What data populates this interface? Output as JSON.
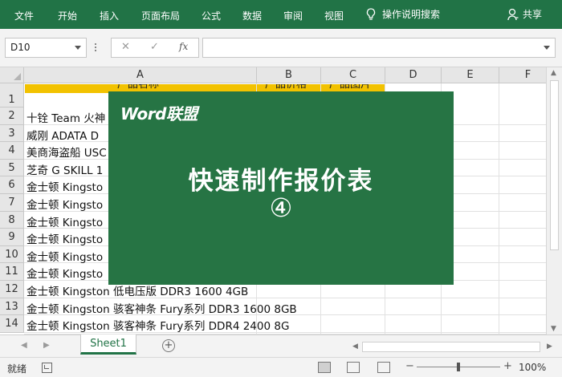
{
  "ribbon": {
    "tabs": [
      "文件",
      "开始",
      "插入",
      "页面布局",
      "公式",
      "数据",
      "审阅",
      "视图"
    ],
    "tell_me": "操作说明搜索",
    "share": "共享",
    "icons": {
      "tell_me": "lightbulb-icon",
      "share": "user-icon"
    }
  },
  "formula_bar": {
    "name_box": "D10",
    "cancel_symbol": "✕",
    "enter_symbol": "✓",
    "fx_symbol": "fx",
    "formula": ""
  },
  "grid": {
    "columns": [
      "A",
      "B",
      "C",
      "D",
      "E",
      "F"
    ],
    "header_row": [
      "产品名称",
      "产品价格",
      "产品图片"
    ],
    "rows": [
      "1",
      "2",
      "3",
      "4",
      "5",
      "6",
      "7",
      "8",
      "9",
      "10",
      "11",
      "12",
      "13",
      "14"
    ],
    "cells_a": [
      "",
      "十铨 Team 火神",
      "威刚 ADATA D",
      "美商海盗船 USC",
      "芝奇 G SKILL 1",
      "金士顿 Kingsto",
      "金士顿 Kingsto",
      "金士顿 Kingsto",
      "金士顿 Kingsto",
      "金士顿 Kingsto",
      "金士顿 Kingsto",
      "金士顿 Kingston 低电压版 DDR3 1600 4GB",
      "金士顿 Kingston 骇客神条 Fury系列 DDR3 1600 8GB",
      "金士顿 Kingston 骇客神条 Fury系列 DDR4 2400 8G"
    ],
    "header_fill_color": "#f2c200"
  },
  "sheets": {
    "tabs": [
      "Sheet1"
    ],
    "add_icon": "plus-circle-icon"
  },
  "status_bar": {
    "ready": "就绪",
    "zoom": "100%",
    "zoom_fraction": 0.5
  },
  "banner": {
    "brand": "Word联盟",
    "title": "快速制作报价表",
    "number": "④",
    "background": "#267444"
  },
  "theme": {
    "accent": "#217346"
  }
}
